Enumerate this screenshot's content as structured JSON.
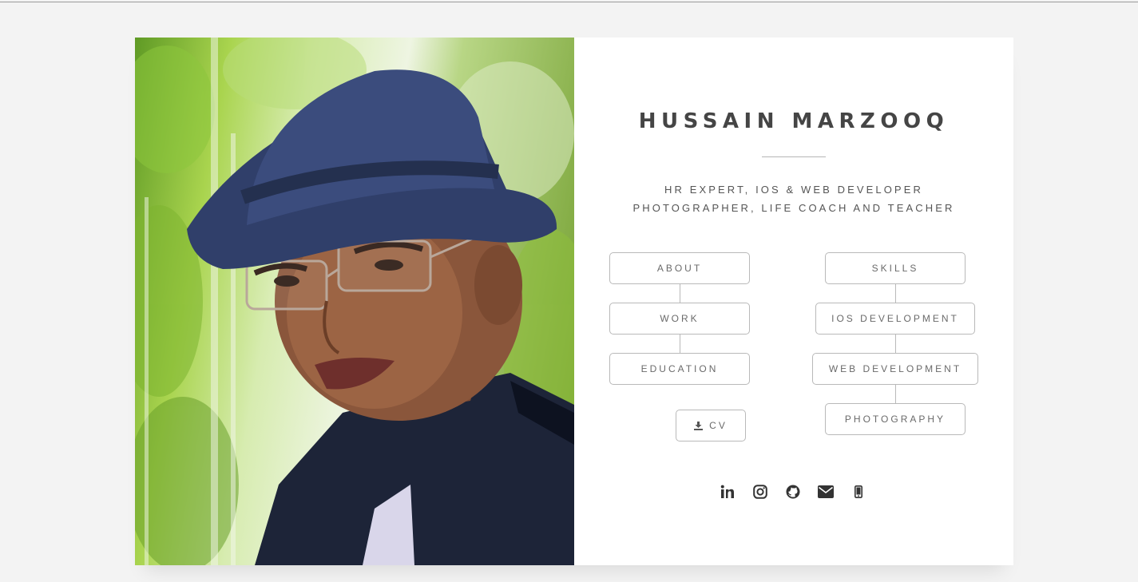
{
  "profile": {
    "name": "HUSSAIN MARZOOQ",
    "subtitle_line1": "HR EXPERT, IOS & WEB DEVELOPER",
    "subtitle_line2": "PHOTOGRAPHER, LIFE COACH AND TEACHER"
  },
  "nav_left": [
    {
      "label": "ABOUT"
    },
    {
      "label": "WORK"
    },
    {
      "label": "EDUCATION"
    }
  ],
  "nav_right": [
    {
      "label": "SKILLS"
    },
    {
      "label": "IOS DEVELOPMENT"
    },
    {
      "label": "WEB DEVELOPMENT"
    },
    {
      "label": "PHOTOGRAPHY"
    }
  ],
  "cv_button": {
    "label": "CV",
    "icon": "download-icon"
  },
  "socials": [
    {
      "icon": "linkedin-icon"
    },
    {
      "icon": "instagram-icon"
    },
    {
      "icon": "github-icon"
    },
    {
      "icon": "email-icon"
    },
    {
      "icon": "phone-icon"
    }
  ],
  "colors": {
    "page_background": "#f3f3f3",
    "card_background": "#ffffff",
    "text_dark": "#454545",
    "button_border": "#b9b9b9",
    "icon_color": "#333333"
  }
}
